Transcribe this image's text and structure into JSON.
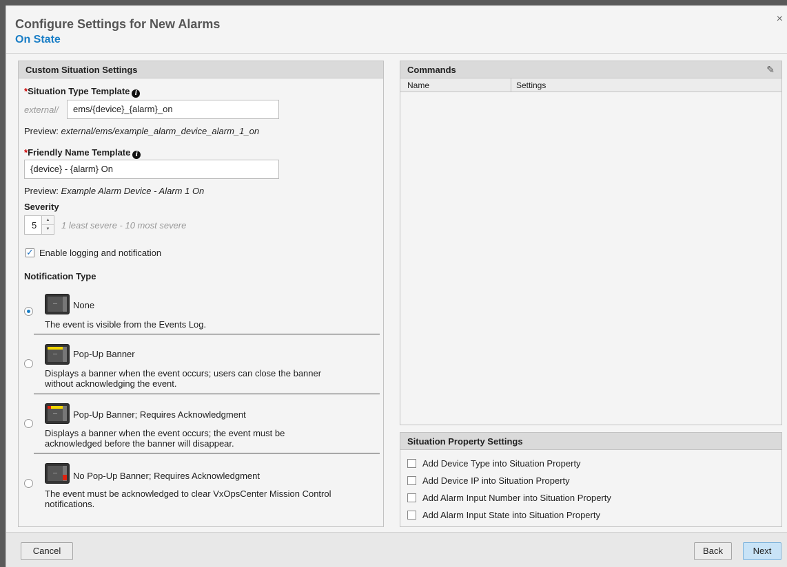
{
  "dialog": {
    "title": "Configure Settings for New Alarms",
    "subtitle": "On State",
    "close_label": "×"
  },
  "custom": {
    "header": "Custom Situation Settings",
    "type_template_label": "Situation Type Template",
    "type_prefix": "external/",
    "type_value": "ems/{device}_{alarm}_on",
    "type_preview_prefix": "Preview: ",
    "type_preview": "external/ems/example_alarm_device_alarm_1_on",
    "friendly_label": "Friendly Name Template",
    "friendly_value": "{device} - {alarm} On",
    "friendly_preview_prefix": "Preview: ",
    "friendly_preview": "Example Alarm Device - Alarm 1 On",
    "severity_label": "Severity",
    "severity_value": "5",
    "severity_hint": "1 least severe - 10 most severe",
    "enable_logging_label": "Enable logging and notification",
    "enable_logging_checked": true,
    "notification_type_label": "Notification Type",
    "notification_options": [
      {
        "label": "None",
        "description": "The event is visible from the Events Log.",
        "selected": true,
        "icon": "device-none-icon"
      },
      {
        "label": "Pop-Up Banner",
        "description_line1": "Displays a banner when the event occurs; users can close the banner",
        "description_line2": "without acknowledging the event.",
        "selected": false,
        "icon": "device-banner-icon"
      },
      {
        "label": "Pop-Up Banner; Requires Acknowledgment",
        "description_line1": "Displays a banner when the event occurs; the event must be",
        "description_line2": "acknowledged before the banner will disappear.",
        "selected": false,
        "icon": "device-banner-ack-icon"
      },
      {
        "label": "No Pop-Up Banner; Requires Acknowledgment",
        "description_line1": "The event must be acknowledged to clear VxOpsCenter Mission Control",
        "description_line2": "notifications.",
        "selected": false,
        "icon": "device-noban-ack-icon"
      }
    ]
  },
  "commands": {
    "header": "Commands",
    "columns": [
      "Name",
      "Settings"
    ],
    "rows": []
  },
  "properties": {
    "header": "Situation Property Settings",
    "items": [
      {
        "label": "Add Device Type into Situation Property",
        "checked": false
      },
      {
        "label": "Add Device IP into Situation Property",
        "checked": false
      },
      {
        "label": "Add Alarm Input Number into Situation Property",
        "checked": false
      },
      {
        "label": "Add Alarm Input State into Situation Property",
        "checked": false
      }
    ]
  },
  "footer": {
    "cancel": "Cancel",
    "back": "Back",
    "next": "Next"
  },
  "colors": {
    "accent": "#1a7ec6",
    "required": "#cc0000",
    "primary_button": "#c8e3f7"
  }
}
